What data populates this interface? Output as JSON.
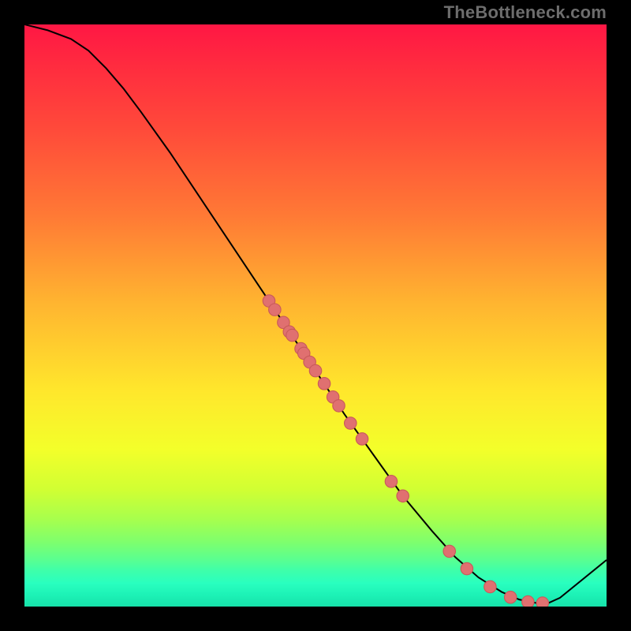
{
  "watermark": "TheBottleneck.com",
  "colors": {
    "curve_stroke": "#000000",
    "point_fill": "#e07070",
    "point_stroke": "#c85a5a"
  },
  "chart_data": {
    "type": "line",
    "title": "",
    "xlabel": "",
    "ylabel": "",
    "xlim": [
      0,
      100
    ],
    "ylim": [
      0,
      100
    ],
    "series": [
      {
        "name": "curve",
        "x": [
          0,
          4,
          8,
          11,
          14,
          17,
          20,
          25,
          30,
          35,
          40,
          45,
          50,
          55,
          60,
          65,
          70,
          74,
          78,
          82,
          85,
          88,
          90,
          92,
          100
        ],
        "y": [
          100,
          99,
          97.5,
          95.5,
          92.5,
          89,
          85,
          78,
          70.5,
          63,
          55.5,
          48,
          40.5,
          33,
          26,
          19,
          13,
          8.5,
          5,
          2.5,
          1.2,
          0.6,
          0.6,
          1.5,
          8
        ]
      }
    ],
    "points": [
      {
        "x": 42,
        "y": 52.5
      },
      {
        "x": 43,
        "y": 51
      },
      {
        "x": 44.5,
        "y": 48.8
      },
      {
        "x": 45.5,
        "y": 47.2
      },
      {
        "x": 46,
        "y": 46.6
      },
      {
        "x": 47.5,
        "y": 44.3
      },
      {
        "x": 48,
        "y": 43.5
      },
      {
        "x": 49,
        "y": 42
      },
      {
        "x": 50,
        "y": 40.5
      },
      {
        "x": 51.5,
        "y": 38.3
      },
      {
        "x": 53,
        "y": 36
      },
      {
        "x": 54,
        "y": 34.5
      },
      {
        "x": 56,
        "y": 31.5
      },
      {
        "x": 58,
        "y": 28.8
      },
      {
        "x": 63,
        "y": 21.5
      },
      {
        "x": 65,
        "y": 19
      },
      {
        "x": 73,
        "y": 9.5
      },
      {
        "x": 76,
        "y": 6.5
      },
      {
        "x": 80,
        "y": 3.4
      },
      {
        "x": 83.5,
        "y": 1.6
      },
      {
        "x": 86.5,
        "y": 0.8
      },
      {
        "x": 89,
        "y": 0.6
      }
    ]
  }
}
